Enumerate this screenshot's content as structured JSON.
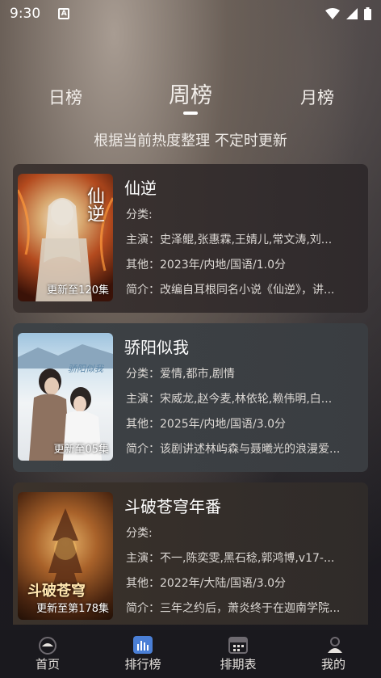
{
  "status_bar": {
    "time": "9:30",
    "notification_icon": "A"
  },
  "tabs": {
    "day": "日榜",
    "week": "周榜",
    "month": "月榜"
  },
  "subtitle": "根据当前热度整理 不定时更新",
  "shows": [
    {
      "title": "仙逆",
      "category": "分类:",
      "cast": "主演：史泽鲲,张惠霖,王婧儿,常文涛,刘...",
      "other": "其他：2023年/内地/国语/1.0分",
      "intro": "简介：改编自耳根同名小说《仙逆》，讲...",
      "episode": "更新至120集",
      "poster_text": "仙逆"
    },
    {
      "title": "骄阳似我",
      "category": "分类：爱情,都市,剧情",
      "cast": "主演：宋威龙,赵今麦,林依轮,赖伟明,白...",
      "other": "其他：2025年/内地/国语/3.0分",
      "intro": "简介：该剧讲述林屿森与聂曦光的浪漫爱...",
      "episode": "更新至05集",
      "poster_text": "骄阳似我"
    },
    {
      "title": "斗破苍穹年番",
      "category": "分类:",
      "cast": "主演：不一,陈奕雯,黑石稔,郭鸿博,v17-...",
      "other": "其他：2022年/大陆/国语/3.0分",
      "intro": "简介：三年之约后，萧炎终于在迦南学院...",
      "episode": "更新至第178集",
      "poster_text": "斗破苍穹"
    }
  ],
  "nav": {
    "home": "首页",
    "ranking": "排行榜",
    "schedule": "排期表",
    "mine": "我的"
  }
}
